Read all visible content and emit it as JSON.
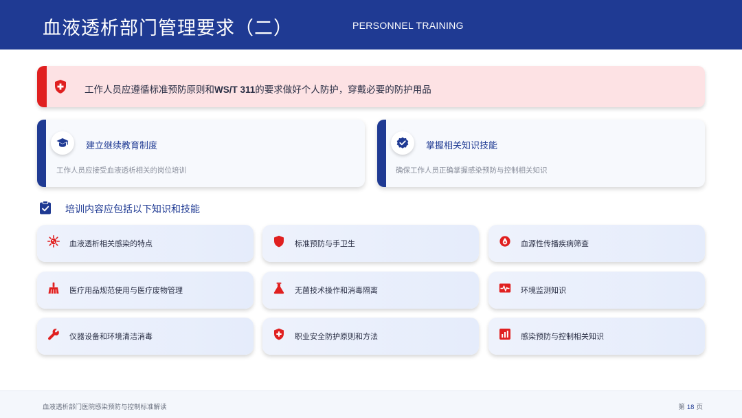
{
  "header": {
    "title": "血液透析部门管理要求（二）",
    "subtitle": "PERSONNEL TRAINING"
  },
  "alert": {
    "icon": "shield-plus-icon",
    "text_before": "工作人员应遵循标准预防原则和",
    "text_bold": "WS/T 311",
    "text_after": "的要求做好个人防护，穿戴必要的防护用品"
  },
  "cards": [
    {
      "icon": "graduation-cap-icon",
      "title": "建立继续教育制度",
      "desc": "工作人员应接受血液透析相关的岗位培训"
    },
    {
      "icon": "verified-badge-icon",
      "title": "掌握相关知识技能",
      "desc": "确保工作人员正确掌握感染预防与控制相关知识"
    }
  ],
  "section": {
    "icon": "clipboard-check-icon",
    "title": "培训内容应包括以下知识和技能"
  },
  "items": [
    {
      "icon": "virus-icon",
      "label": "血液透析相关感染的特点"
    },
    {
      "icon": "shield-icon",
      "label": "标准预防与手卫生"
    },
    {
      "icon": "blood-drop-icon",
      "label": "血源性传播疾病筛查"
    },
    {
      "icon": "broom-icon",
      "label": "医疗用品规范使用与医疗废物管理"
    },
    {
      "icon": "flask-icon",
      "label": "无菌技术操作和消毒隔离"
    },
    {
      "icon": "heart-pulse-icon",
      "label": "环境监测知识"
    },
    {
      "icon": "wrench-icon",
      "label": "仪器设备和环境清洁消毒"
    },
    {
      "icon": "shield-plus-icon",
      "label": "职业安全防护原则和方法"
    },
    {
      "icon": "bar-chart-icon",
      "label": "感染预防与控制相关知识"
    }
  ],
  "footer": {
    "left": "血液透析部门医院感染预防与控制标准解读",
    "page_prefix": "第",
    "page_number": "18",
    "page_suffix": "页"
  },
  "colors": {
    "brand_blue": "#1f3a93",
    "alert_red": "#e02020",
    "alert_bg": "#fde2e4",
    "icon_red": "#e02020"
  }
}
